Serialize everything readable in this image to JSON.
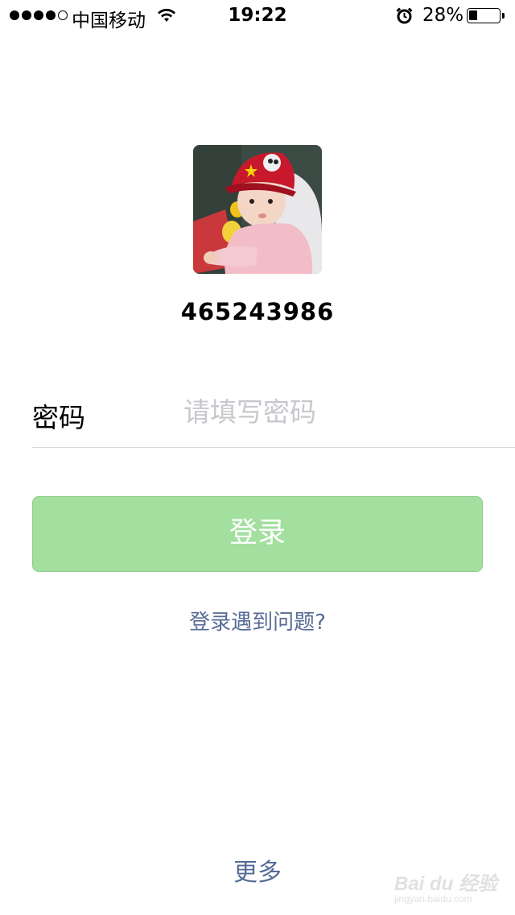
{
  "status_bar": {
    "carrier": "中国移动",
    "time": "19:22",
    "battery_percent_text": "28%",
    "battery_level": 0.28,
    "signal_bars_filled": 4,
    "signal_bars_total": 5,
    "icons": [
      "wifi-icon",
      "alarm-icon",
      "battery-icon"
    ]
  },
  "profile": {
    "account_id": "465243986",
    "avatar_desc": "avatar"
  },
  "login_form": {
    "password_label": "密码",
    "password_placeholder": "请填写密码",
    "password_value": ""
  },
  "actions": {
    "login_button": "登录",
    "help_link": "登录遇到问题?",
    "more_link": "更多"
  },
  "colors": {
    "accent_green": "#a3df9f",
    "link_blue": "#576b95",
    "placeholder_gray": "#c7c7cd"
  },
  "watermark": {
    "logo": "Bai du 经验",
    "url": "jingyan.baidu.com"
  }
}
